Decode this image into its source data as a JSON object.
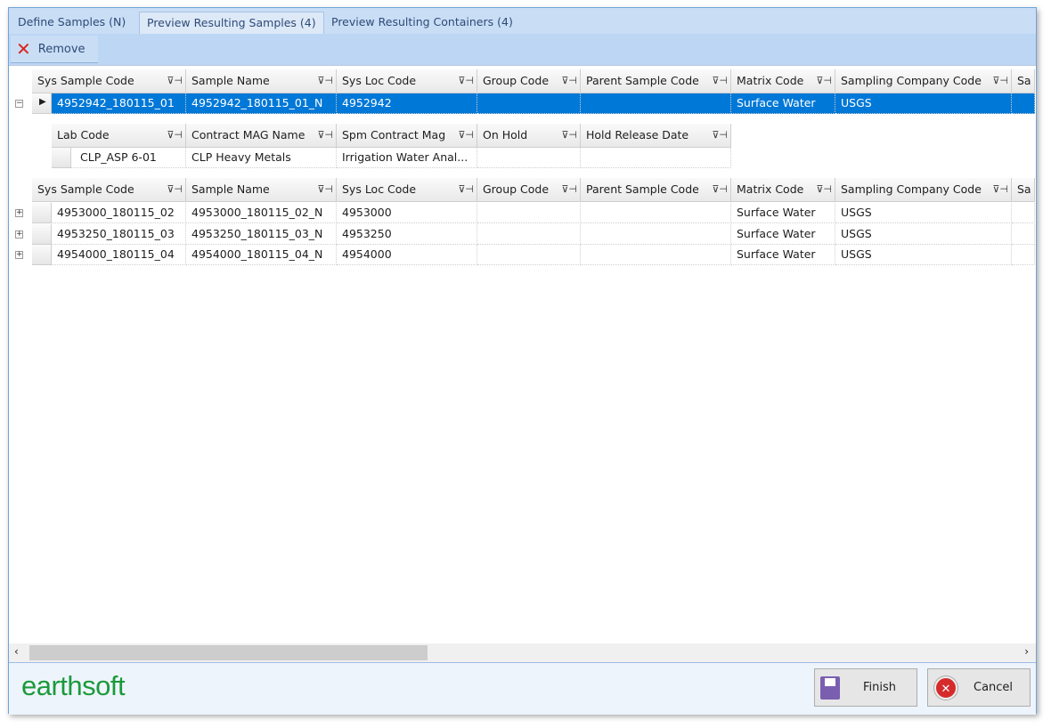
{
  "tabs": [
    {
      "label": "Define Samples (N)"
    },
    {
      "label": "Preview Resulting Samples (4)"
    },
    {
      "label": "Preview Resulting Containers (4)"
    }
  ],
  "toolbar": {
    "remove_label": "Remove"
  },
  "columns": [
    "Sys Sample Code",
    "Sample Name",
    "Sys Loc Code",
    "Group Code",
    "Parent Sample Code",
    "Matrix Code",
    "Sampling Company Code",
    "Sa"
  ],
  "child_columns": [
    "Lab Code",
    "Contract MAG Name",
    "Spm Contract Mag",
    "On Hold",
    "Hold Release Date"
  ],
  "selected_row": {
    "cells": [
      "4952942_180115_01",
      "4952942_180115_01_N",
      "4952942",
      "",
      "",
      "Surface Water",
      "USGS",
      ""
    ]
  },
  "child_rows": [
    {
      "cells": [
        "CLP_ASP 6-01",
        "CLP Heavy Metals",
        "Irrigation Water Anal...",
        "",
        ""
      ]
    }
  ],
  "rows": [
    {
      "cells": [
        "4953000_180115_02",
        "4953000_180115_02_N",
        "4953000",
        "",
        "",
        "Surface Water",
        "USGS",
        ""
      ]
    },
    {
      "cells": [
        "4953250_180115_03",
        "4953250_180115_03_N",
        "4953250",
        "",
        "",
        "Surface Water",
        "USGS",
        ""
      ]
    },
    {
      "cells": [
        "4954000_180115_04",
        "4954000_180115_04_N",
        "4954000",
        "",
        "",
        "Surface Water",
        "USGS",
        ""
      ]
    }
  ],
  "footer": {
    "logo_text": "earthsoft",
    "finish_label": "Finish",
    "cancel_label": "Cancel"
  },
  "colors": {
    "selection": "#0078d7",
    "logo_green": "#1a9a3a",
    "tab_bar": "#c9def5"
  }
}
